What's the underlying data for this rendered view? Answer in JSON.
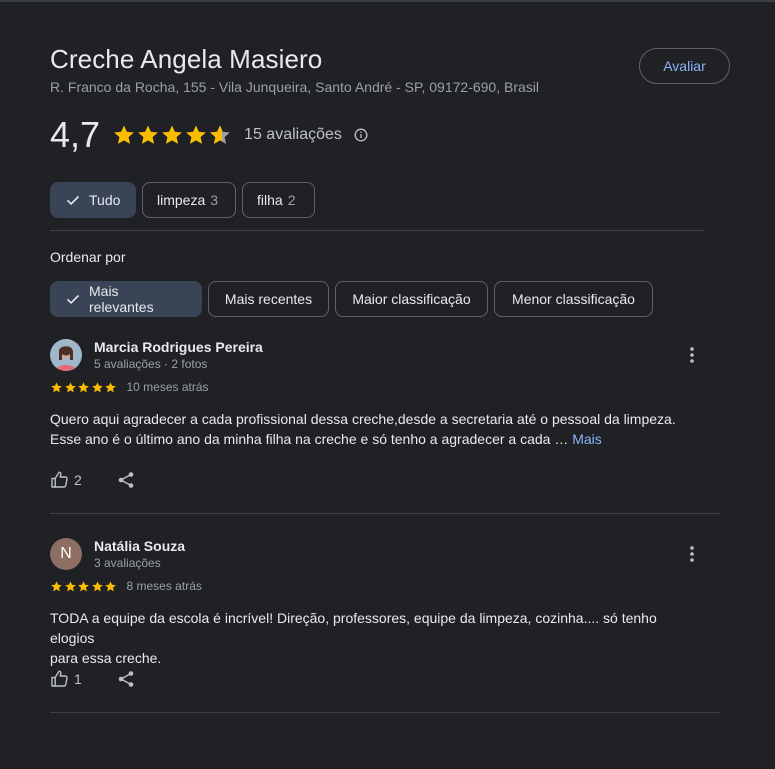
{
  "place": {
    "name": "Creche Angela Masiero",
    "address": "R. Franco da Rocha, 155 - Vila Junqueira, Santo André - SP, 09172-690, Brasil",
    "rate_button": "Avaliar",
    "rating": "4,7",
    "rating_value": 4.7,
    "reviews_count": "15 avaliações"
  },
  "topic_chips": [
    {
      "label": "Tudo",
      "badge": "",
      "selected": true
    },
    {
      "label": "limpeza",
      "badge": "3",
      "selected": false
    },
    {
      "label": "filha",
      "badge": "2",
      "selected": false
    }
  ],
  "sort": {
    "label": "Ordenar por",
    "options": [
      {
        "label": "Mais relevantes",
        "selected": true
      },
      {
        "label": "Mais recentes",
        "selected": false
      },
      {
        "label": "Maior classificação",
        "selected": false
      },
      {
        "label": "Menor classificação",
        "selected": false
      }
    ]
  },
  "reviews": [
    {
      "name": "Marcia Rodrigues Pereira",
      "meta": "5 avaliações · 2 fotos",
      "stars": 5,
      "time": "10 meses atrás",
      "text_line1": "Quero aqui agradecer a cada profissional dessa creche,desde a secretaria até o pessoal da limpeza.",
      "text_line2": "Esse ano é o último ano da minha filha na creche e só tenho a agradecer a cada …",
      "more": "Mais",
      "likes": "2"
    },
    {
      "name": "Natália Souza",
      "avatar_letter": "N",
      "meta": "3 avaliações",
      "stars": 5,
      "time": "8 meses atrás",
      "text_line1": "TODA a equipe da escola é incrível! Direção, professores, equipe da limpeza, cozinha.... só tenho elogios",
      "text_line2": "para essa creche.",
      "likes": "1"
    }
  ],
  "colors": {
    "background": "#202124",
    "accent_link": "#8ab4f8",
    "star": "#fbbc04",
    "selected_chip": "#394457"
  }
}
